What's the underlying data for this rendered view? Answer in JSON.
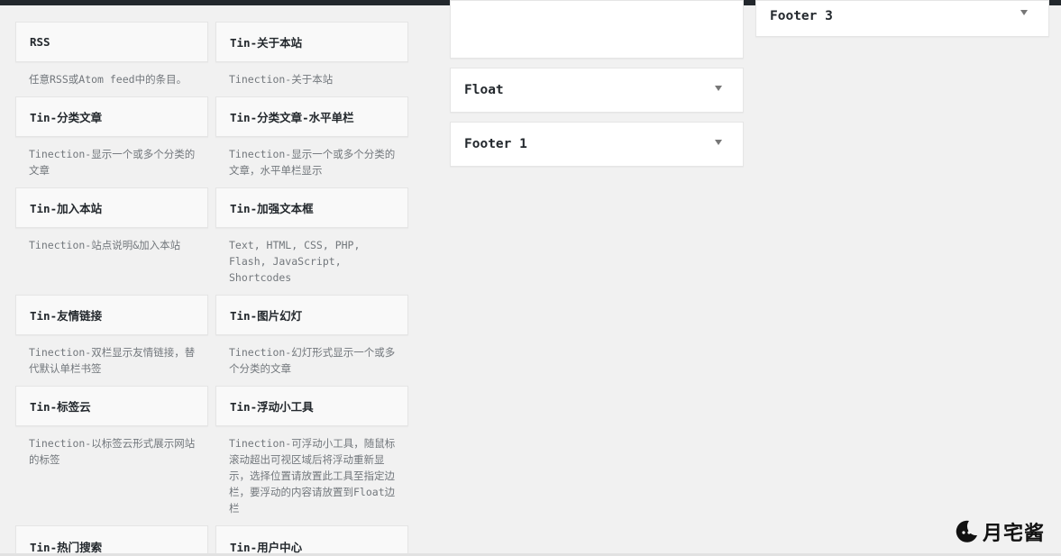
{
  "available_widgets": [
    {
      "title": "RSS",
      "desc": "任意RSS或Atom feed中的条目。"
    },
    {
      "title": "Tin-关于本站",
      "desc": "Tinection-关于本站"
    },
    {
      "title": "Tin-分类文章",
      "desc": "Tinection-显示一个或多个分类的文章"
    },
    {
      "title": "Tin-分类文章-水平单栏",
      "desc": "Tinection-显示一个或多个分类的文章，水平单栏显示"
    },
    {
      "title": "Tin-加入本站",
      "desc": "Tinection-站点说明&加入本站"
    },
    {
      "title": "Tin-加强文本框",
      "desc": "Text, HTML, CSS, PHP, Flash, JavaScript, Shortcodes"
    },
    {
      "title": "Tin-友情链接",
      "desc": "Tinection-双栏显示友情链接，替代默认单栏书签"
    },
    {
      "title": "Tin-图片幻灯",
      "desc": "Tinection-幻灯形式显示一个或多个分类的文章"
    },
    {
      "title": "Tin-标签云",
      "desc": "Tinection-以标签云形式展示网站的标签"
    },
    {
      "title": "Tin-浮动小工具",
      "desc": "Tinection-可浮动小工具，随鼠标滚动超出可视区域后将浮动重新显示，选择位置请放置此工具至指定边栏，要浮动的内容请放置到Float边栏"
    },
    {
      "title": "Tin-热门搜索",
      "desc": ""
    },
    {
      "title": "Tin-用户中心",
      "desc": ""
    }
  ],
  "sidebars": {
    "float": {
      "title": "Float"
    },
    "footer1": {
      "title": "Footer 1"
    },
    "footer3": {
      "title": "Footer 3"
    }
  },
  "watermark": {
    "text": "月宅酱"
  },
  "colors": {
    "topbar": "#23282d",
    "widget_bg": "#f9f9f9",
    "page_bg": "#f1f1f1"
  }
}
